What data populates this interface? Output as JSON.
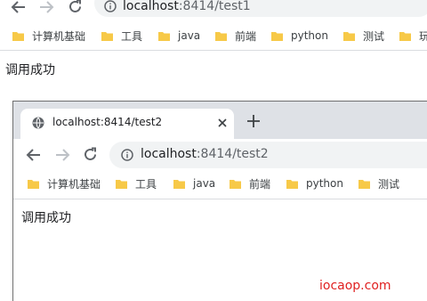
{
  "outer": {
    "url_host": "localhost",
    "url_rest": ":8414/test1",
    "bookmarks": [
      "计算机基础",
      "工具",
      "java",
      "前端",
      "python",
      "测试",
      "玩"
    ],
    "page_text": "调用成功"
  },
  "inner": {
    "tab_title": "localhost:8414/test2",
    "url_host": "localhost",
    "url_rest": ":8414/test2",
    "bookmarks": [
      "计算机基础",
      "工具",
      "java",
      "前端",
      "python",
      "测试"
    ],
    "page_text": "调用成功"
  },
  "watermark": "iocaop.com",
  "colors": {
    "folder": "#f7c948",
    "tabstrip": "#dee1e6",
    "omnibox": "#f1f3f4",
    "watermark": "#e02020"
  }
}
